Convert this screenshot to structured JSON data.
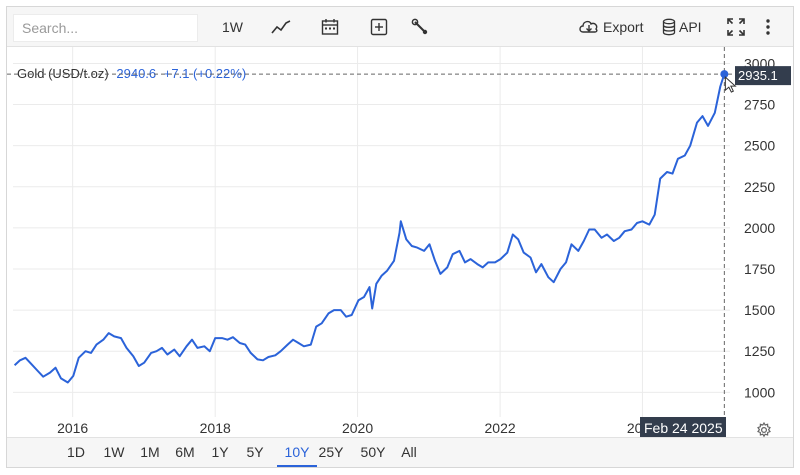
{
  "search": {
    "placeholder": "Search..."
  },
  "toolbar": {
    "interval_label": "1W",
    "chart_type_icon": "line-chart-icon",
    "calendar_icon": "calendar-icon",
    "add_icon": "plus-box-icon",
    "tools_icon": "wrench-icon",
    "export_label": "Export",
    "export_icon": "cloud-download-icon",
    "api_label": "API",
    "api_icon": "database-icon",
    "fullscreen_icon": "fullscreen-icon",
    "menu_icon": "more-vertical-icon"
  },
  "header": {
    "name": "Gold (USD/t.oz)",
    "price": "2940.6",
    "change": "+7.1 (+0.22%)"
  },
  "crosshair": {
    "price_label": "2935.1",
    "date_label": "Feb 24 2025"
  },
  "ranges": [
    "1D",
    "1W",
    "1M",
    "6M",
    "1Y",
    "5Y",
    "10Y",
    "25Y",
    "50Y",
    "All"
  ],
  "active_range": "10Y",
  "settings_icon": "gear-icon",
  "colors": {
    "line": "#2b63d9",
    "active": "#2b63d9",
    "label_bg": "#333d4d"
  },
  "chart_data": {
    "type": "line",
    "ylim": [
      850,
      3100
    ],
    "xlim": [
      "2015-03-01",
      "2025-03-25"
    ],
    "y_ticks": [
      1000,
      1250,
      1500,
      1750,
      2000,
      2250,
      2500,
      2750,
      3000
    ],
    "x_tick_labels": [
      "2016",
      "2018",
      "2020",
      "2022",
      "2024"
    ],
    "x_tick_dates": [
      "2016-01-01",
      "2018-01-01",
      "2020-01-01",
      "2022-01-01",
      "2024-01-01"
    ],
    "grid": true,
    "series": [
      {
        "name": "Gold (USD/t.oz)",
        "x": [
          "2015-03-09",
          "2015-04-06",
          "2015-05-04",
          "2015-06-01",
          "2015-07-06",
          "2015-08-03",
          "2015-09-07",
          "2015-10-05",
          "2015-11-02",
          "2015-12-07",
          "2016-01-04",
          "2016-02-01",
          "2016-03-07",
          "2016-04-04",
          "2016-05-02",
          "2016-06-06",
          "2016-07-04",
          "2016-08-01",
          "2016-09-05",
          "2016-10-03",
          "2016-11-07",
          "2016-12-05",
          "2017-01-02",
          "2017-02-06",
          "2017-03-06",
          "2017-04-03",
          "2017-05-01",
          "2017-06-05",
          "2017-07-03",
          "2017-08-07",
          "2017-09-04",
          "2017-10-02",
          "2017-11-06",
          "2017-12-04",
          "2018-01-01",
          "2018-02-05",
          "2018-03-05",
          "2018-04-02",
          "2018-05-07",
          "2018-06-04",
          "2018-07-02",
          "2018-08-06",
          "2018-09-03",
          "2018-10-01",
          "2018-11-05",
          "2018-12-03",
          "2019-01-07",
          "2019-02-04",
          "2019-03-04",
          "2019-04-01",
          "2019-05-06",
          "2019-06-03",
          "2019-07-01",
          "2019-08-05",
          "2019-09-02",
          "2019-10-07",
          "2019-11-04",
          "2019-12-02",
          "2020-01-06",
          "2020-02-03",
          "2020-03-02",
          "2020-03-16",
          "2020-04-06",
          "2020-05-04",
          "2020-06-01",
          "2020-07-06",
          "2020-08-03",
          "2020-08-10",
          "2020-09-07",
          "2020-10-05",
          "2020-11-02",
          "2020-12-07",
          "2021-01-04",
          "2021-02-01",
          "2021-03-01",
          "2021-04-05",
          "2021-05-03",
          "2021-06-07",
          "2021-07-05",
          "2021-08-02",
          "2021-09-06",
          "2021-10-04",
          "2021-11-01",
          "2021-12-06",
          "2022-01-03",
          "2022-02-07",
          "2022-03-07",
          "2022-04-04",
          "2022-05-02",
          "2022-06-06",
          "2022-07-04",
          "2022-08-01",
          "2022-09-05",
          "2022-10-03",
          "2022-11-07",
          "2022-12-05",
          "2023-01-02",
          "2023-02-06",
          "2023-03-06",
          "2023-04-03",
          "2023-05-01",
          "2023-06-05",
          "2023-07-03",
          "2023-08-07",
          "2023-09-04",
          "2023-10-02",
          "2023-11-06",
          "2023-12-04",
          "2024-01-01",
          "2024-02-05",
          "2024-03-04",
          "2024-04-01",
          "2024-05-06",
          "2024-06-03",
          "2024-07-01",
          "2024-08-05",
          "2024-09-02",
          "2024-10-07",
          "2024-11-04",
          "2024-12-02",
          "2025-01-06",
          "2025-02-03",
          "2025-02-24"
        ],
        "values": [
          1165,
          1195,
          1210,
          1175,
          1130,
          1095,
          1120,
          1150,
          1085,
          1060,
          1100,
          1210,
          1250,
          1240,
          1290,
          1320,
          1360,
          1340,
          1330,
          1270,
          1220,
          1160,
          1180,
          1240,
          1250,
          1270,
          1230,
          1260,
          1220,
          1280,
          1320,
          1270,
          1280,
          1250,
          1330,
          1330,
          1320,
          1335,
          1300,
          1290,
          1240,
          1200,
          1195,
          1215,
          1225,
          1250,
          1290,
          1320,
          1300,
          1280,
          1290,
          1400,
          1420,
          1480,
          1500,
          1500,
          1460,
          1470,
          1560,
          1580,
          1640,
          1510,
          1660,
          1710,
          1740,
          1800,
          1970,
          2040,
          1930,
          1890,
          1880,
          1860,
          1900,
          1800,
          1720,
          1760,
          1840,
          1860,
          1790,
          1810,
          1780,
          1760,
          1790,
          1790,
          1810,
          1850,
          1960,
          1930,
          1850,
          1820,
          1730,
          1780,
          1700,
          1670,
          1750,
          1790,
          1900,
          1860,
          1920,
          1990,
          1990,
          1940,
          1960,
          1920,
          1940,
          1980,
          1990,
          2030,
          2040,
          2020,
          2080,
          2300,
          2340,
          2330,
          2420,
          2440,
          2500,
          2640,
          2680,
          2620,
          2700,
          2860,
          2935.1
        ]
      }
    ]
  }
}
